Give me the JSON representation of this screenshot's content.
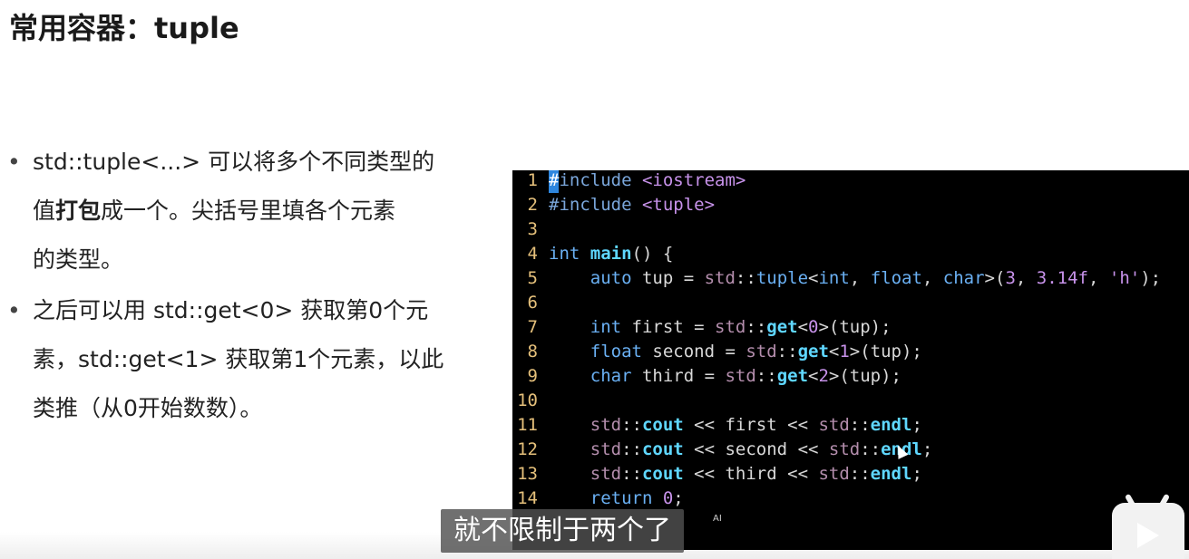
{
  "slide": {
    "title": "常用容器：tuple",
    "bullets": [
      {
        "lines": [
          [
            {
              "t": "std::tuple<...> 可以将多个不同类型的",
              "b": false
            }
          ],
          [
            {
              "t": "值",
              "b": false
            },
            {
              "t": "打包",
              "b": true
            },
            {
              "t": "成一个。尖括号里填各个元素",
              "b": false
            }
          ],
          [
            {
              "t": "的类型。",
              "b": false
            }
          ]
        ]
      },
      {
        "lines": [
          [
            {
              "t": "之后可以用 std::get<0> 获取第0个元",
              "b": false
            }
          ],
          [
            {
              "t": "素，std::get<1> 获取第1个元素，以此",
              "b": false
            }
          ],
          [
            {
              "t": "类推（从0开始数数）。",
              "b": false
            }
          ]
        ]
      }
    ]
  },
  "code": {
    "lines": [
      {
        "n": "1",
        "tokens": [
          {
            "t": "#",
            "c": "cursor"
          },
          {
            "t": "include ",
            "c": "inc"
          },
          {
            "t": "<iostream>",
            "c": "str"
          }
        ]
      },
      {
        "n": "2",
        "tokens": [
          {
            "t": "#include ",
            "c": "inc"
          },
          {
            "t": "<tuple>",
            "c": "str"
          }
        ]
      },
      {
        "n": "3",
        "tokens": []
      },
      {
        "n": "4",
        "tokens": [
          {
            "t": "int ",
            "c": "kw"
          },
          {
            "t": "main",
            "c": "fn"
          },
          {
            "t": "() {",
            "c": ""
          }
        ]
      },
      {
        "n": "5",
        "tokens": [
          {
            "t": "    auto",
            "c": "kw"
          },
          {
            "t": " tup = ",
            "c": ""
          },
          {
            "t": "std",
            "c": "ns"
          },
          {
            "t": "::",
            "c": ""
          },
          {
            "t": "tuple",
            "c": "kw"
          },
          {
            "t": "<",
            "c": ""
          },
          {
            "t": "int",
            "c": "kw"
          },
          {
            "t": ", ",
            "c": ""
          },
          {
            "t": "float",
            "c": "kw"
          },
          {
            "t": ", ",
            "c": ""
          },
          {
            "t": "char",
            "c": "kw"
          },
          {
            "t": ">(",
            "c": ""
          },
          {
            "t": "3",
            "c": "num"
          },
          {
            "t": ", ",
            "c": ""
          },
          {
            "t": "3.14f",
            "c": "num"
          },
          {
            "t": ", ",
            "c": ""
          },
          {
            "t": "'h'",
            "c": "str"
          },
          {
            "t": ");",
            "c": ""
          }
        ]
      },
      {
        "n": "6",
        "tokens": []
      },
      {
        "n": "7",
        "tokens": [
          {
            "t": "    int",
            "c": "kw"
          },
          {
            "t": " first = ",
            "c": ""
          },
          {
            "t": "std",
            "c": "ns"
          },
          {
            "t": "::",
            "c": ""
          },
          {
            "t": "get",
            "c": "fn"
          },
          {
            "t": "<",
            "c": ""
          },
          {
            "t": "0",
            "c": "num"
          },
          {
            "t": ">(tup);",
            "c": ""
          }
        ]
      },
      {
        "n": "8",
        "tokens": [
          {
            "t": "    float",
            "c": "kw"
          },
          {
            "t": " second = ",
            "c": ""
          },
          {
            "t": "std",
            "c": "ns"
          },
          {
            "t": "::",
            "c": ""
          },
          {
            "t": "get",
            "c": "fn"
          },
          {
            "t": "<",
            "c": ""
          },
          {
            "t": "1",
            "c": "num"
          },
          {
            "t": ">(tup);",
            "c": ""
          }
        ]
      },
      {
        "n": "9",
        "tokens": [
          {
            "t": "    char",
            "c": "kw"
          },
          {
            "t": " third = ",
            "c": ""
          },
          {
            "t": "std",
            "c": "ns"
          },
          {
            "t": "::",
            "c": ""
          },
          {
            "t": "get",
            "c": "fn"
          },
          {
            "t": "<",
            "c": ""
          },
          {
            "t": "2",
            "c": "num"
          },
          {
            "t": ">(tup);",
            "c": ""
          }
        ]
      },
      {
        "n": "10",
        "tokens": []
      },
      {
        "n": "11",
        "tokens": [
          {
            "t": "    std",
            "c": "ns"
          },
          {
            "t": "::",
            "c": ""
          },
          {
            "t": "cout",
            "c": "fn"
          },
          {
            "t": " << first << ",
            "c": ""
          },
          {
            "t": "std",
            "c": "ns"
          },
          {
            "t": "::",
            "c": ""
          },
          {
            "t": "endl",
            "c": "fn"
          },
          {
            "t": ";",
            "c": ""
          }
        ]
      },
      {
        "n": "12",
        "tokens": [
          {
            "t": "    std",
            "c": "ns"
          },
          {
            "t": "::",
            "c": ""
          },
          {
            "t": "cout",
            "c": "fn"
          },
          {
            "t": " << second << ",
            "c": ""
          },
          {
            "t": "std",
            "c": "ns"
          },
          {
            "t": "::",
            "c": ""
          },
          {
            "t": "endl",
            "c": "fn"
          },
          {
            "t": ";",
            "c": ""
          }
        ]
      },
      {
        "n": "13",
        "tokens": [
          {
            "t": "    std",
            "c": "ns"
          },
          {
            "t": "::",
            "c": ""
          },
          {
            "t": "cout",
            "c": "fn"
          },
          {
            "t": " << third << ",
            "c": ""
          },
          {
            "t": "std",
            "c": "ns"
          },
          {
            "t": "::",
            "c": ""
          },
          {
            "t": "endl",
            "c": "fn"
          },
          {
            "t": ";",
            "c": ""
          }
        ]
      },
      {
        "n": "14",
        "tokens": [
          {
            "t": "    return ",
            "c": "kw"
          },
          {
            "t": "0",
            "c": "num"
          },
          {
            "t": ";",
            "c": ""
          }
        ]
      }
    ]
  },
  "overlay": {
    "subtitle": "就不限制于两个了",
    "ai_tag": "AI"
  }
}
